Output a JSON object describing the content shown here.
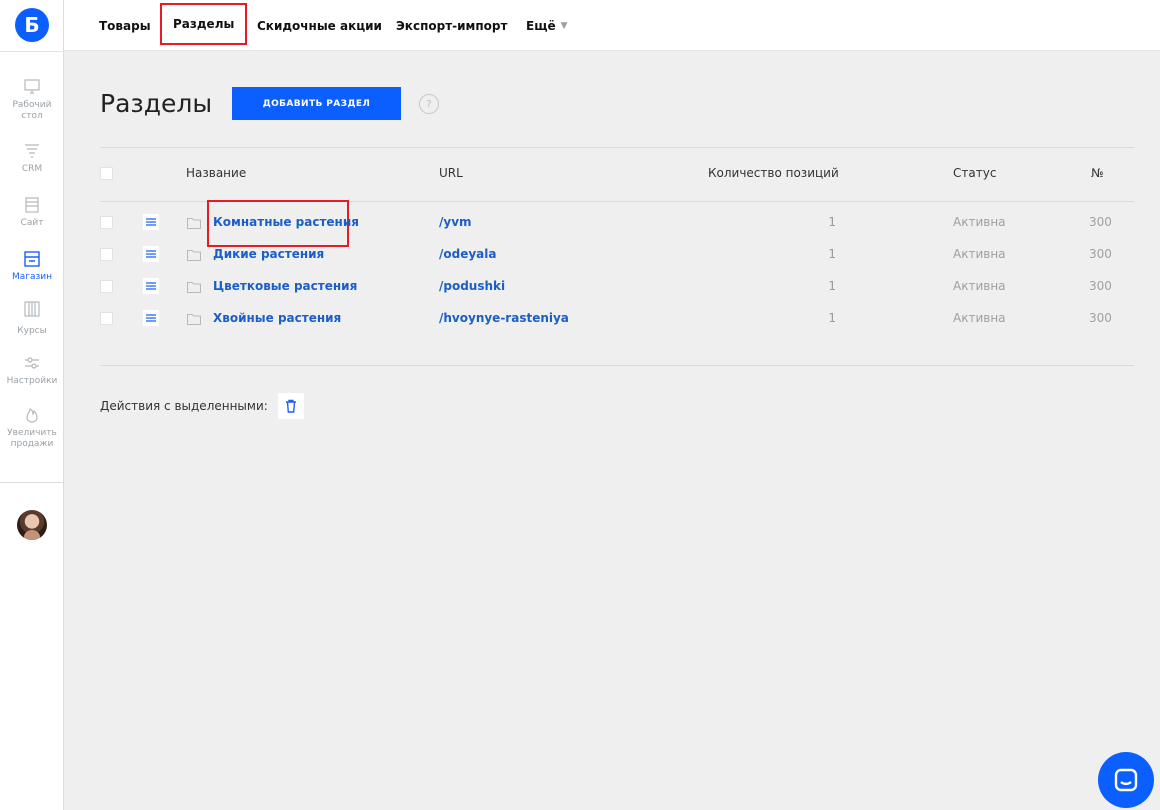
{
  "logo": {
    "letter": "Б"
  },
  "sidebar": {
    "items": [
      {
        "label_line1": "Рабочий",
        "label_line2": "стол",
        "icon": "desktop-icon"
      },
      {
        "label_line1": "CRM",
        "label_line2": "",
        "icon": "funnel-icon"
      },
      {
        "label_line1": "Сайт",
        "label_line2": "",
        "icon": "site-icon"
      },
      {
        "label_line1": "Магазин",
        "label_line2": "",
        "icon": "store-icon",
        "active": true
      },
      {
        "label_line1": "Курсы",
        "label_line2": "",
        "icon": "courses-icon"
      },
      {
        "label_line1": "Настройки",
        "label_line2": "",
        "icon": "settings-icon"
      },
      {
        "label_line1": "Увеличить",
        "label_line2": "продажи",
        "icon": "fire-icon"
      }
    ]
  },
  "topnav": {
    "items": [
      "Товары",
      "Разделы",
      "Скидочные акции",
      "Экспорт-импорт",
      "Ещё"
    ],
    "active": "Разделы"
  },
  "page": {
    "title": "Разделы",
    "add_button": "ДОБАВИТЬ РАЗДЕЛ",
    "help": "?"
  },
  "table": {
    "headers": {
      "name": "Название",
      "url": "URL",
      "count": "Количество позиций",
      "status": "Статус",
      "num": "№"
    },
    "rows": [
      {
        "name": "Комнатные растения",
        "url": "/yvm",
        "count": "1",
        "status": "Активна",
        "num": "300"
      },
      {
        "name": "Дикие растения",
        "url": "/odeyala",
        "count": "1",
        "status": "Активна",
        "num": "300"
      },
      {
        "name": "Цветковые растения",
        "url": "/podushki",
        "count": "1",
        "status": "Активна",
        "num": "300"
      },
      {
        "name": "Хвойные растения",
        "url": "/hvoynye-rasteniya",
        "count": "1",
        "status": "Активна",
        "num": "300"
      }
    ]
  },
  "bulk": {
    "label": "Действия с выделенными:"
  },
  "colors": {
    "accent": "#0b5fff",
    "link": "#1a5fc8",
    "highlight": "#e51c23"
  }
}
